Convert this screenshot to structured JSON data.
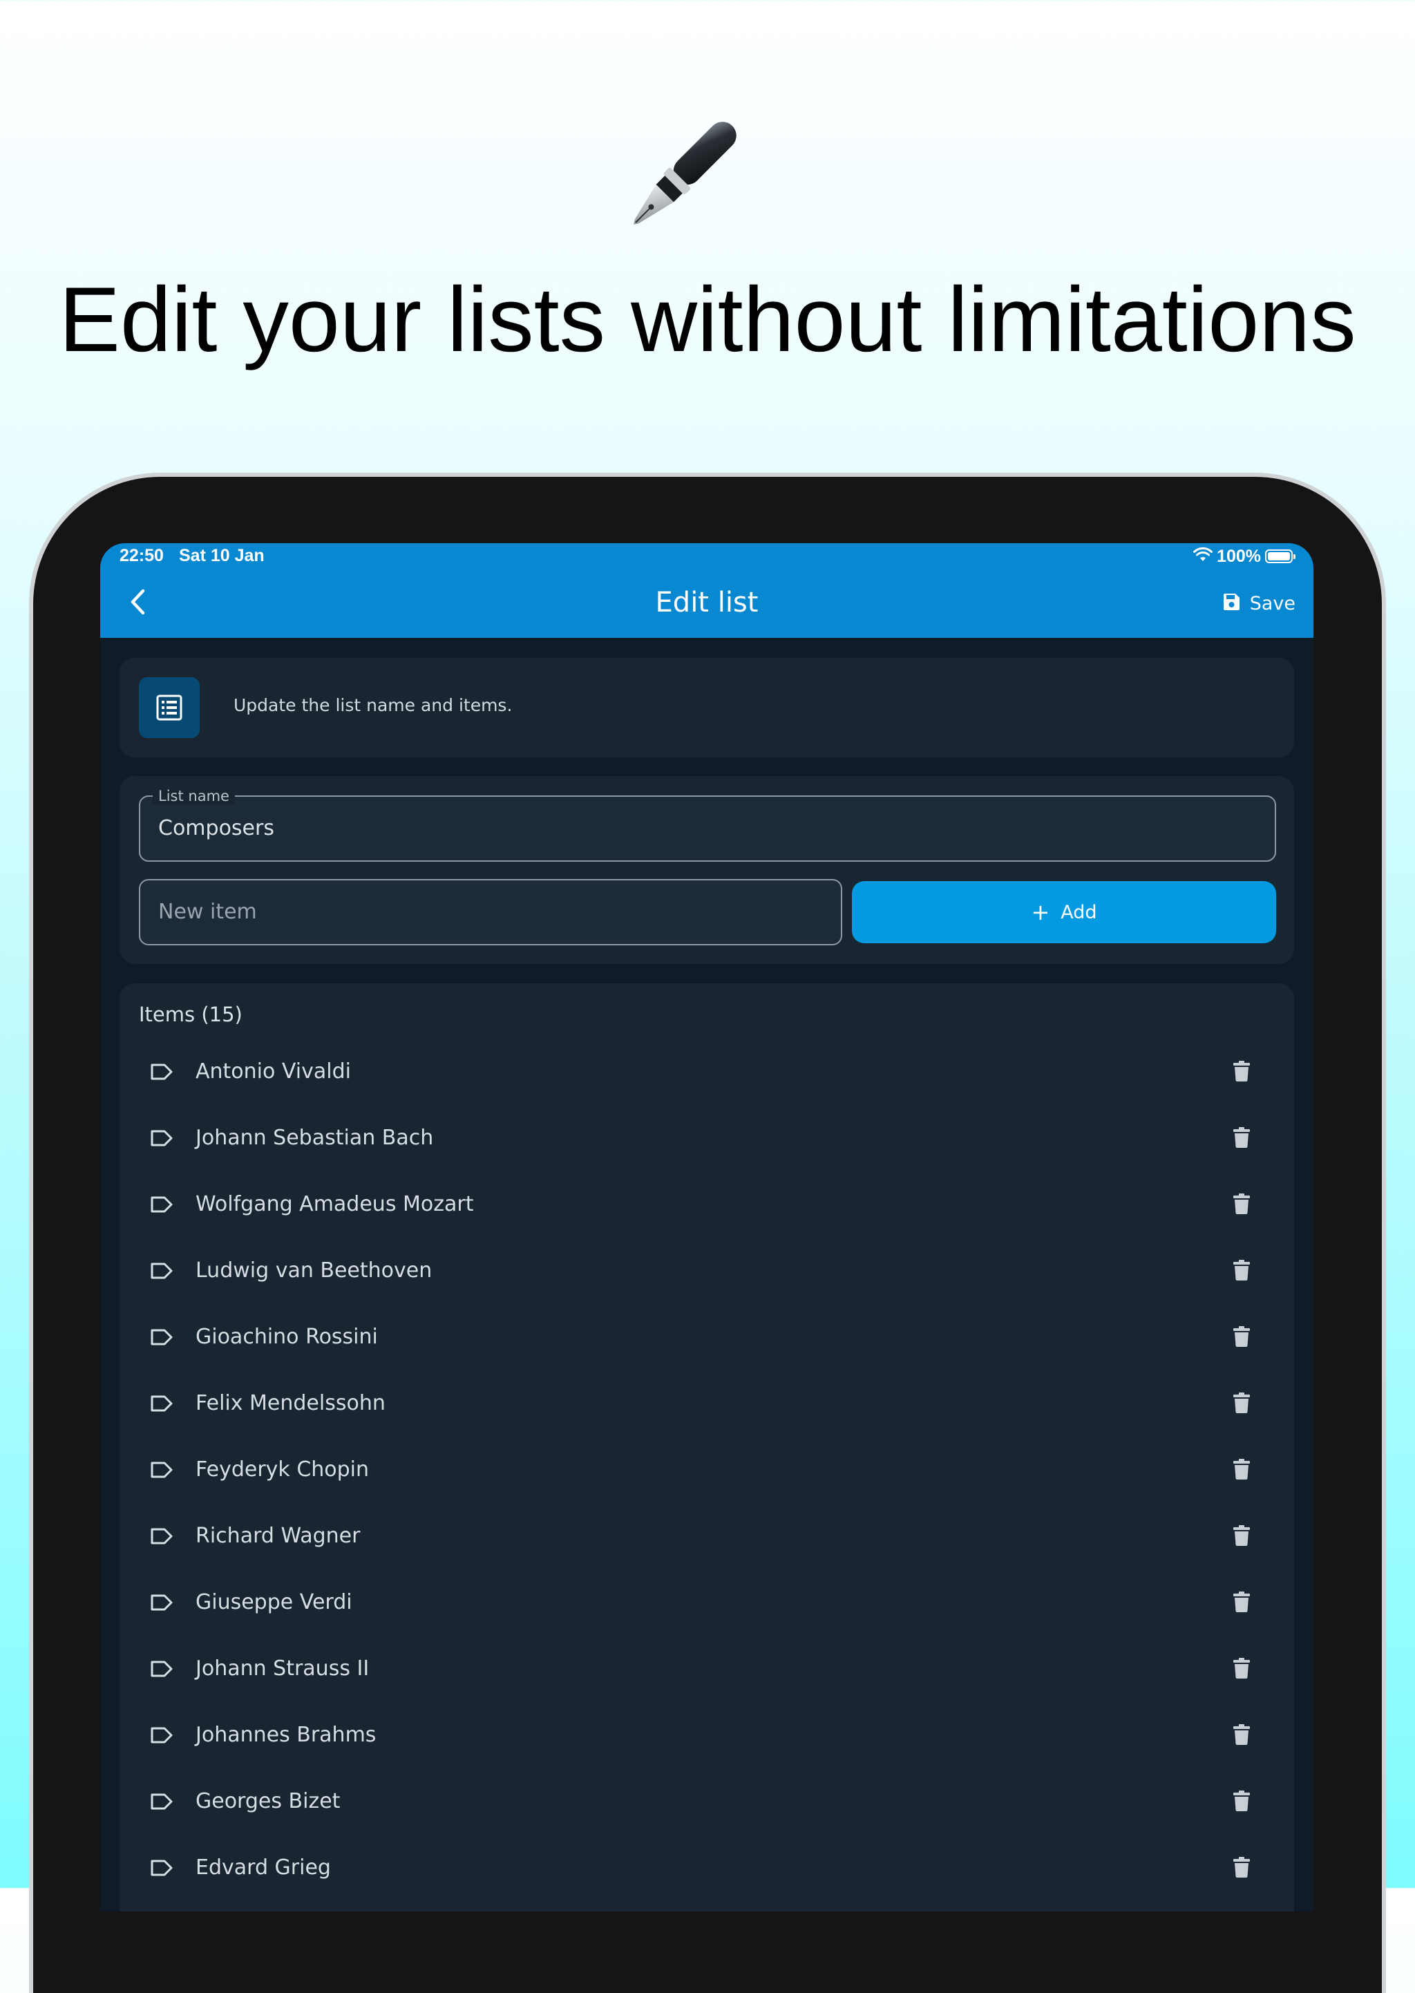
{
  "headline": "Edit your lists without limitations",
  "status_bar": {
    "time": "22:50",
    "date": "Sat 10 Jan",
    "battery": "100%"
  },
  "app_bar": {
    "title": "Edit list",
    "save_label": "Save"
  },
  "info_card": {
    "text": "Update the list name and items."
  },
  "form": {
    "list_name_label": "List name",
    "list_name_value": "Composers",
    "new_item_placeholder": "New item",
    "add_label": "Add",
    "add_symbol": "+"
  },
  "items": {
    "header": "Items (15)",
    "entries": [
      "Antonio Vivaldi",
      "Johann Sebastian Bach",
      "Wolfgang Amadeus Mozart",
      "Ludwig van Beethoven",
      "Gioachino Rossini",
      "Felix Mendelssohn",
      "Feyderyk Chopin",
      "Richard Wagner",
      "Giuseppe Verdi",
      "Johann Strauss II",
      "Johannes Brahms",
      "Georges Bizet",
      "Edvard Grieg"
    ]
  },
  "colors": {
    "app_bar": "#0788d0",
    "add_button": "#049ae2",
    "screen_background": "#0f1c27",
    "card_background": "#192632"
  },
  "icons": {
    "hero": "fountain-pen-icon",
    "back": "chevron-left-icon",
    "save": "floppy-disk-icon",
    "info": "list-icon",
    "item": "label-tag-icon",
    "delete": "trash-icon",
    "wifi": "wifi-icon",
    "battery": "battery-icon"
  }
}
